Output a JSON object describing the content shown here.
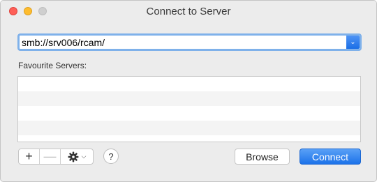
{
  "window": {
    "title": "Connect to Server"
  },
  "address": {
    "value": "smb://srv006/rcam/",
    "dropdown_icon": "chevron-down-icon"
  },
  "favourites": {
    "label": "Favourite Servers:",
    "items": []
  },
  "controls": {
    "add_symbol": "+",
    "remove_symbol": "—",
    "action_icon": "gear-icon",
    "help_symbol": "?",
    "browse_label": "Browse",
    "connect_label": "Connect"
  },
  "colors": {
    "accent": "#1c72e9",
    "close": "#fe5f57",
    "minimize": "#febc2e",
    "zoom_disabled": "#cfcfcf"
  }
}
